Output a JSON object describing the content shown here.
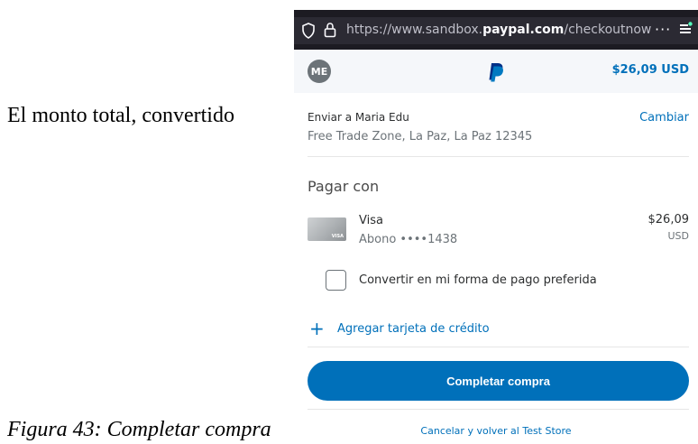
{
  "document": {
    "line_text": "El monto total, convertido",
    "caption": "Figura 43: Completar compra"
  },
  "browser": {
    "url_prefix": "https://www.sandbox.",
    "url_domain": "paypal.com",
    "url_suffix": "/checkoutnow?",
    "menu_dots": "···",
    "icons": [
      "shield-icon",
      "lock-icon",
      "extension-icon"
    ]
  },
  "checkout": {
    "avatar_initials": "ME",
    "total": "$26,09 USD",
    "ship_label": "Enviar a Maria Edu",
    "ship_change": "Cambiar",
    "ship_address": "Free Trade Zone, La Paz, La Paz 12345",
    "pay_title": "Pagar con",
    "card_brand_mark": "VISA",
    "card_name": "Visa",
    "card_sub": "Abono ••••1438",
    "card_amount": "$26,09",
    "card_currency": "USD",
    "convert_label": "Convertir en mi forma de pago preferida",
    "add_card_label": "Agregar tarjeta de crédito",
    "complete_button": "Completar compra",
    "cancel_link": "Cancelar y volver al Test Store"
  },
  "colors": {
    "accent": "#0070ba",
    "browser_bar": "#1c1b22",
    "header_bg": "#f5f7fa"
  }
}
